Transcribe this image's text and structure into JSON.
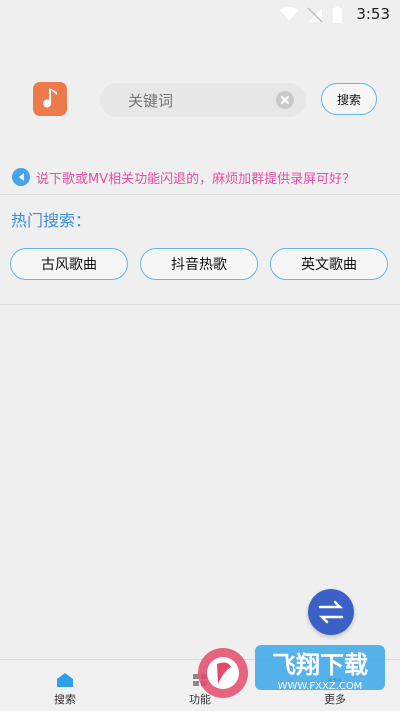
{
  "status_bar": {
    "time": "3:53",
    "icons": [
      "wifi-icon",
      "signal-icon",
      "battery-icon"
    ]
  },
  "search": {
    "placeholder": "关键词",
    "button_label": "搜索"
  },
  "notice": {
    "text": "说下歌或MV相关功能闪退的，麻烦加群提供录屏可好？"
  },
  "hot": {
    "title": "热门搜索：",
    "tags": [
      "古风歌曲",
      "抖音热歌",
      "英文歌曲"
    ]
  },
  "nav": {
    "items": [
      "搜索",
      "功能",
      "更多"
    ]
  },
  "watermark": {
    "text": "飞翔下载",
    "url_text": "WWW.FXXZ.COM"
  },
  "colors": {
    "accent": "#63b7ea",
    "notice": "#e54fa5",
    "app_icon": "#ee7a4b",
    "fab": "#3b61c7"
  }
}
